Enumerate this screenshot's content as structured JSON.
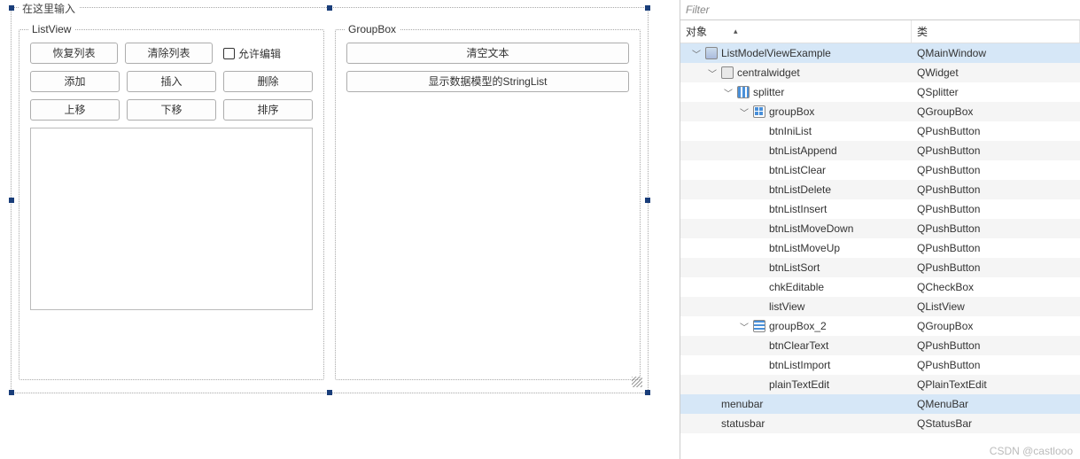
{
  "designer": {
    "form_title": "在这里输入",
    "groupbox_list": {
      "title": "ListView",
      "btn_restore": "恢复列表",
      "btn_clear": "清除列表",
      "chk_edit": "允许编辑",
      "btn_add": "添加",
      "btn_insert": "插入",
      "btn_delete": "删除",
      "btn_moveup": "上移",
      "btn_movedown": "下移",
      "btn_sort": "排序"
    },
    "groupbox_text": {
      "title": "GroupBox",
      "btn_cleartext": "清空文本",
      "btn_showmodel": "显示数据模型的StringList"
    }
  },
  "inspector": {
    "filter_placeholder": "Filter",
    "col_object": "对象",
    "col_class": "类",
    "rows": [
      {
        "depth": 0,
        "exp": "v",
        "icon": "main",
        "name": "ListModelViewExample",
        "cls": "QMainWindow",
        "sel": true
      },
      {
        "depth": 1,
        "exp": "v",
        "icon": "wid",
        "name": "centralwidget",
        "cls": "QWidget"
      },
      {
        "depth": 2,
        "exp": "v",
        "icon": "spl",
        "name": "splitter",
        "cls": "QSplitter"
      },
      {
        "depth": 3,
        "exp": "v",
        "icon": "grp",
        "name": "groupBox",
        "cls": "QGroupBox"
      },
      {
        "depth": 4,
        "exp": "",
        "icon": "",
        "name": "btnIniList",
        "cls": "QPushButton"
      },
      {
        "depth": 4,
        "exp": "",
        "icon": "",
        "name": "btnListAppend",
        "cls": "QPushButton"
      },
      {
        "depth": 4,
        "exp": "",
        "icon": "",
        "name": "btnListClear",
        "cls": "QPushButton"
      },
      {
        "depth": 4,
        "exp": "",
        "icon": "",
        "name": "btnListDelete",
        "cls": "QPushButton"
      },
      {
        "depth": 4,
        "exp": "",
        "icon": "",
        "name": "btnListInsert",
        "cls": "QPushButton"
      },
      {
        "depth": 4,
        "exp": "",
        "icon": "",
        "name": "btnListMoveDown",
        "cls": "QPushButton"
      },
      {
        "depth": 4,
        "exp": "",
        "icon": "",
        "name": "btnListMoveUp",
        "cls": "QPushButton"
      },
      {
        "depth": 4,
        "exp": "",
        "icon": "",
        "name": "btnListSort",
        "cls": "QPushButton"
      },
      {
        "depth": 4,
        "exp": "",
        "icon": "",
        "name": "chkEditable",
        "cls": "QCheckBox"
      },
      {
        "depth": 4,
        "exp": "",
        "icon": "",
        "name": "listView",
        "cls": "QListView"
      },
      {
        "depth": 3,
        "exp": "v",
        "icon": "list",
        "name": "groupBox_2",
        "cls": "QGroupBox"
      },
      {
        "depth": 4,
        "exp": "",
        "icon": "",
        "name": "btnClearText",
        "cls": "QPushButton"
      },
      {
        "depth": 4,
        "exp": "",
        "icon": "",
        "name": "btnListImport",
        "cls": "QPushButton"
      },
      {
        "depth": 4,
        "exp": "",
        "icon": "",
        "name": "plainTextEdit",
        "cls": "QPlainTextEdit"
      },
      {
        "depth": 1,
        "exp": "",
        "icon": "",
        "name": "menubar",
        "cls": "QMenuBar",
        "sel2": true
      },
      {
        "depth": 1,
        "exp": "",
        "icon": "",
        "name": "statusbar",
        "cls": "QStatusBar"
      }
    ]
  },
  "watermark": "CSDN @castlooo"
}
